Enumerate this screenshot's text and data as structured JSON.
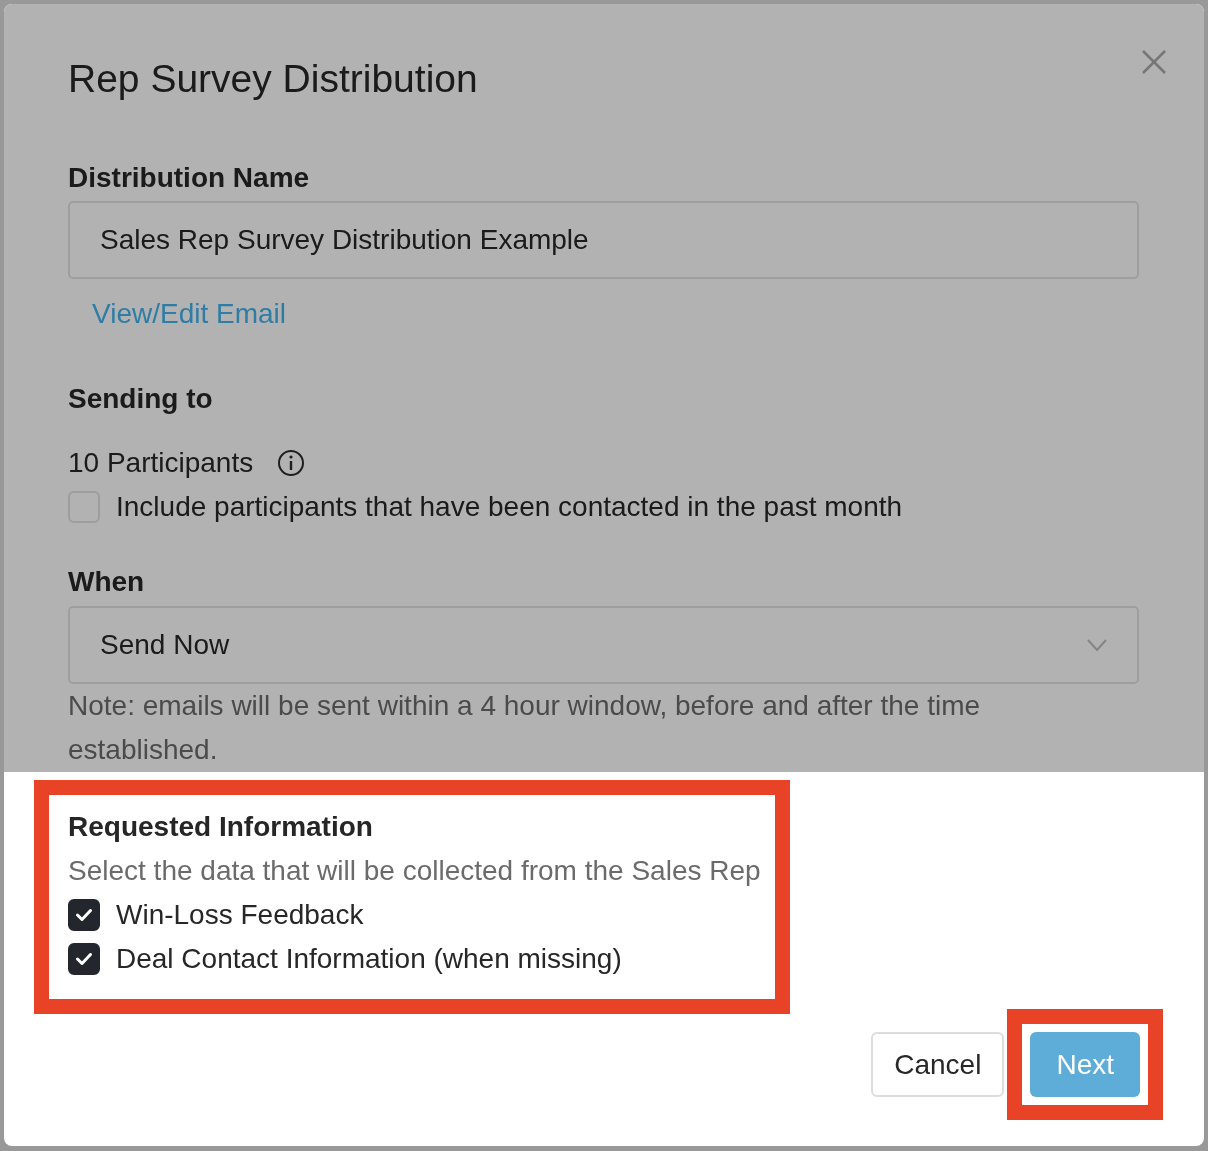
{
  "upper_panel": {
    "dimmed": true,
    "title": "Rep Survey Distribution",
    "distribution_name": {
      "label": "Distribution Name",
      "value": "Sales Rep Survey Distribution Example",
      "link": "View/Edit Email"
    },
    "sending_to": {
      "label": "Sending to",
      "participants": "10 Participants",
      "include_option": {
        "label": "Include participants that have been contacted in the past month",
        "checked": false
      }
    },
    "when": {
      "label": "When",
      "value": "Send Now",
      "note": "Note: emails will be sent within a 4 hour window, before and after the time established."
    }
  },
  "requested_information": {
    "highlighted": true,
    "title": "Requested Information",
    "description": "Select the data that will be collected from the Sales Rep",
    "options": [
      {
        "label": "Win-Loss Feedback",
        "checked": true
      },
      {
        "label": "Deal Contact Information (when missing)",
        "checked": true
      }
    ]
  },
  "buttons": [
    {
      "label": "Cancel",
      "kind": "secondary",
      "highlighted": false
    },
    {
      "label": "Next",
      "kind": "primary",
      "highlighted": true
    }
  ]
}
